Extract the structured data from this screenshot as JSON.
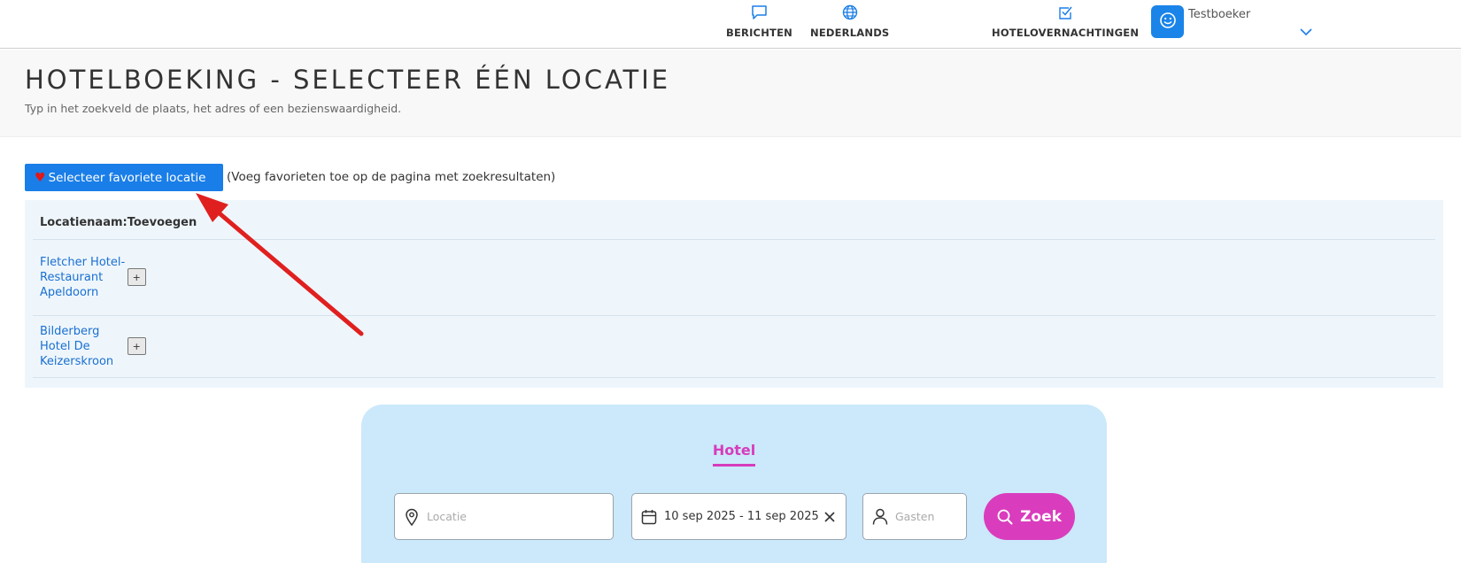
{
  "nav": {
    "berichten": "BERICHTEN",
    "language": "NEDERLANDS",
    "hotelovernachtingen": "HOTELOVERNACHTINGEN",
    "user_name": "Testboeker"
  },
  "header": {
    "title": "HOTELBOEKING - SELECTEER ÉÉN LOCATIE",
    "subtitle": "Typ in het zoekveld de plaats, het adres of een bezienswaardigheid."
  },
  "favorites": {
    "button_label": "Selecteer favoriete locatie",
    "hint": "(Voeg favorieten toe op de pagina met zoekresultaten)"
  },
  "table": {
    "columns": [
      "Locatienaam:",
      "Toevoegen"
    ],
    "rows": [
      {
        "name": "Fletcher Hotel-Restaurant Apeldoorn",
        "add": "+"
      },
      {
        "name": "Bilderberg Hotel De Keizerskroon",
        "add": "+"
      }
    ]
  },
  "search": {
    "tab": "Hotel",
    "location_placeholder": "Locatie",
    "date_range": "10 sep 2025 - 11 sep 2025",
    "guests_placeholder": "Gasten",
    "submit_label": "Zoek"
  },
  "colors": {
    "accent_blue": "#1a7ee8",
    "accent_pink": "#d93dbd",
    "arrow_red": "#e0201f",
    "panel_bg": "#eef6fc",
    "card_bg": "#cce8fb"
  },
  "icons": [
    "message-icon",
    "globe-icon",
    "checkbox-icon",
    "smiley-icon",
    "chevron-down-icon",
    "heart-icon",
    "map-pin-icon",
    "calendar-icon",
    "close-icon",
    "user-icon",
    "search-icon"
  ]
}
